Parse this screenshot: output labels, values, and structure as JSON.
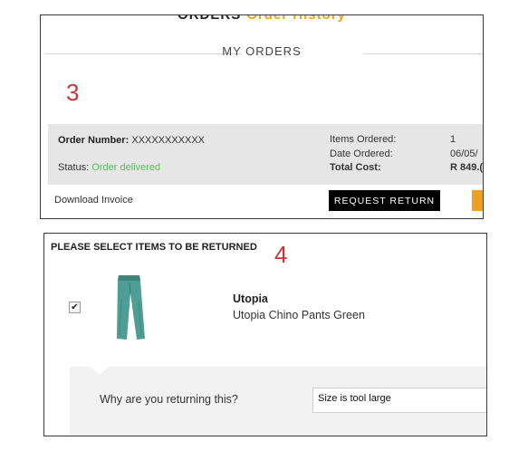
{
  "orders_panel": {
    "breadcrumb": {
      "part1": "ORDERS",
      "part2": "Order History"
    },
    "section_title": "MY ORDERS",
    "step_number": "3",
    "order": {
      "number_label": "Order Number:",
      "number_value": "XXXXXXXXXXX",
      "status_label": "Status:",
      "status_value": "Order delivered",
      "items_label": "Items Ordered:",
      "items_value": "1",
      "date_label": "Date Ordered:",
      "date_value": "06/05/",
      "total_label": "Total Cost:",
      "total_value": "R 849.("
    },
    "download_invoice": "Download Invoice",
    "request_return_button": "REQUEST RETURN"
  },
  "return_panel": {
    "title": "PLEASE SELECT ITEMS TO BE RETURNED",
    "step_number": "4",
    "item": {
      "checked": true,
      "name": "Utopia",
      "description": "Utopia Chino Pants Green"
    },
    "reason_label": "Why are you returning this?",
    "reason_value": "Size is tool large"
  },
  "colors": {
    "accent_orange": "#f0a020",
    "status_green": "#5cb85c",
    "step_red": "#cc3333"
  }
}
